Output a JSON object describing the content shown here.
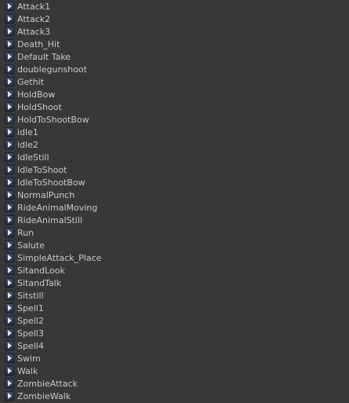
{
  "panel": {
    "item_icon": "animation-clip-play-icon",
    "items": [
      {
        "label": "Attack1"
      },
      {
        "label": "Attack2"
      },
      {
        "label": "Attack3"
      },
      {
        "label": "Death_Hit"
      },
      {
        "label": "Default Take"
      },
      {
        "label": "doublegunshoot"
      },
      {
        "label": "Gethit"
      },
      {
        "label": "HoldBow"
      },
      {
        "label": "HoldShoot"
      },
      {
        "label": "HoldToShootBow"
      },
      {
        "label": "idle1"
      },
      {
        "label": "idle2"
      },
      {
        "label": "IdleStill"
      },
      {
        "label": "IdleToShoot"
      },
      {
        "label": "IdleToShootBow"
      },
      {
        "label": "NormalPunch"
      },
      {
        "label": "RideAnimalMoving"
      },
      {
        "label": "RideAnimalStill"
      },
      {
        "label": "Run"
      },
      {
        "label": "Salute"
      },
      {
        "label": "SimpleAttack_Place"
      },
      {
        "label": "SitandLook"
      },
      {
        "label": "SitandTalk"
      },
      {
        "label": "Sitstill"
      },
      {
        "label": "Spell1"
      },
      {
        "label": "Spell2"
      },
      {
        "label": "Spell3"
      },
      {
        "label": "Spell4"
      },
      {
        "label": "Swim"
      },
      {
        "label": "Walk"
      },
      {
        "label": "ZombieAttack"
      },
      {
        "label": "ZombieWalk"
      }
    ]
  },
  "colors": {
    "background": "#383838",
    "text": "#c9c9c9",
    "icon_fill": "#2d3e52",
    "icon_arrow": "#e0e6ec"
  }
}
